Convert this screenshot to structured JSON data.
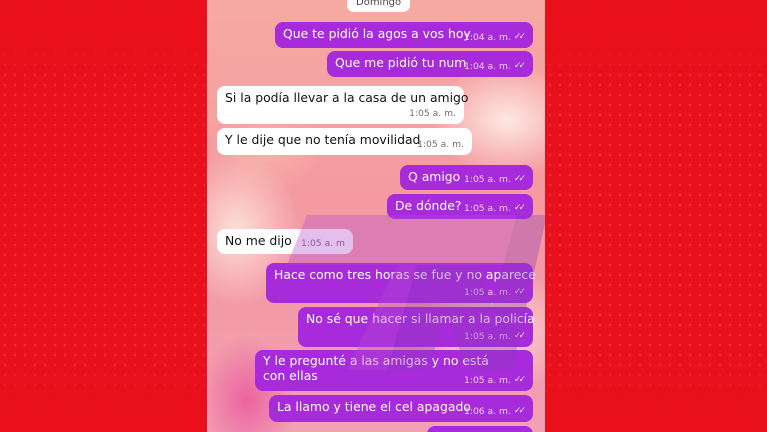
{
  "chat": {
    "date_label": "Domingo",
    "messages": [
      {
        "dir": "out",
        "text": "Que te pidió la agos a vos hoy",
        "time": "1:04 a. m.",
        "status": "read-ticks-icon"
      },
      {
        "dir": "out",
        "text": "Que me pidió tu num",
        "time": "1:04 a. m.",
        "status": "read-ticks-icon"
      },
      {
        "dir": "in",
        "text": "Si la podía llevar a la casa de un amigo",
        "time": "1:05 a. m."
      },
      {
        "dir": "in",
        "text": "Y le dije que no tenía movilidad",
        "time": "1:05 a. m."
      },
      {
        "dir": "out",
        "text": "Q amigo",
        "time": "1:05 a. m.",
        "status": "read-ticks-icon"
      },
      {
        "dir": "out",
        "text": "De dónde?",
        "time": "1:05 a. m.",
        "status": "read-ticks-icon"
      },
      {
        "dir": "in",
        "text": "No me dijo",
        "time": "1:05 a. m"
      },
      {
        "dir": "out",
        "text": "Hace como tres horas se fue y no aparece",
        "time": "1:05 a. m.",
        "status": "read-ticks-icon"
      },
      {
        "dir": "out",
        "text": "No sé que hacer si llamar a la policía",
        "time": "1:05 a. m.",
        "status": "read-ticks-icon"
      },
      {
        "dir": "out",
        "text": "Y le pregunté a las amigas y no está con ellas",
        "time": "1:05 a. m.",
        "status": "read-ticks-icon"
      },
      {
        "dir": "out",
        "text": "La llamo y tiene el cel apagado",
        "time": "1:06 a. m.",
        "status": "read-ticks-icon"
      }
    ]
  },
  "colors": {
    "background": "#e8101c",
    "outgoing_bubble": "#a72adb",
    "incoming_bubble": "#ffffff"
  },
  "watermark_icon": "tn-logo-watermark-icon"
}
